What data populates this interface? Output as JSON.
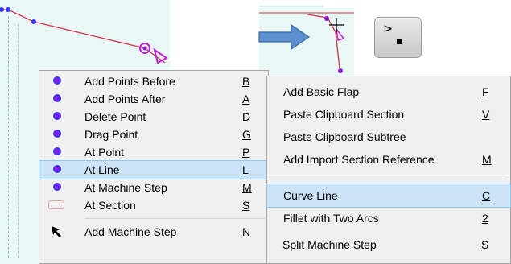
{
  "menu_left": {
    "items": [
      {
        "label": "Add Points Before",
        "shortcut": "B",
        "icon": "purple-point-icon"
      },
      {
        "label": "Add Points After",
        "shortcut": "A",
        "icon": "purple-point-icon"
      },
      {
        "label": "Delete Point",
        "shortcut": "D",
        "icon": "purple-point-icon"
      },
      {
        "label": "Drag Point",
        "shortcut": "G",
        "icon": "purple-point-icon"
      },
      {
        "label": "At Point",
        "shortcut": "P",
        "icon": "purple-point-icon"
      },
      {
        "label": "At Line",
        "shortcut": "L",
        "icon": "purple-point-icon",
        "selected": true
      },
      {
        "label": "At Machine Step",
        "shortcut": "M",
        "icon": "purple-point-icon"
      },
      {
        "label": "At Section",
        "shortcut": "S",
        "icon": "section-rect-icon"
      },
      {
        "label": "Add Machine Step",
        "shortcut": "N",
        "icon": "cursor-arrow-icon"
      }
    ]
  },
  "menu_right": {
    "items": [
      {
        "label": "Add Basic Flap",
        "shortcut": "F"
      },
      {
        "label": "Paste Clipboard Section",
        "shortcut": "V"
      },
      {
        "label": "Paste Clipboard Subtree",
        "shortcut": ""
      },
      {
        "label": "Add Import Section Reference",
        "shortcut": "M"
      },
      {
        "label": "Curve Line",
        "shortcut": "C",
        "selected": true
      },
      {
        "label": "Fillet with Two Arcs",
        "shortcut": "2"
      },
      {
        "label": "Split Machine Step",
        "shortcut": "S"
      }
    ]
  },
  "prompt": {
    "symbol": ">"
  },
  "colors": {
    "selection": "#cbe4f7",
    "canvas": "#e9f8f4",
    "point": "#8a1ad6",
    "line": "#d8334a",
    "arrow": "#4f7fc0"
  }
}
